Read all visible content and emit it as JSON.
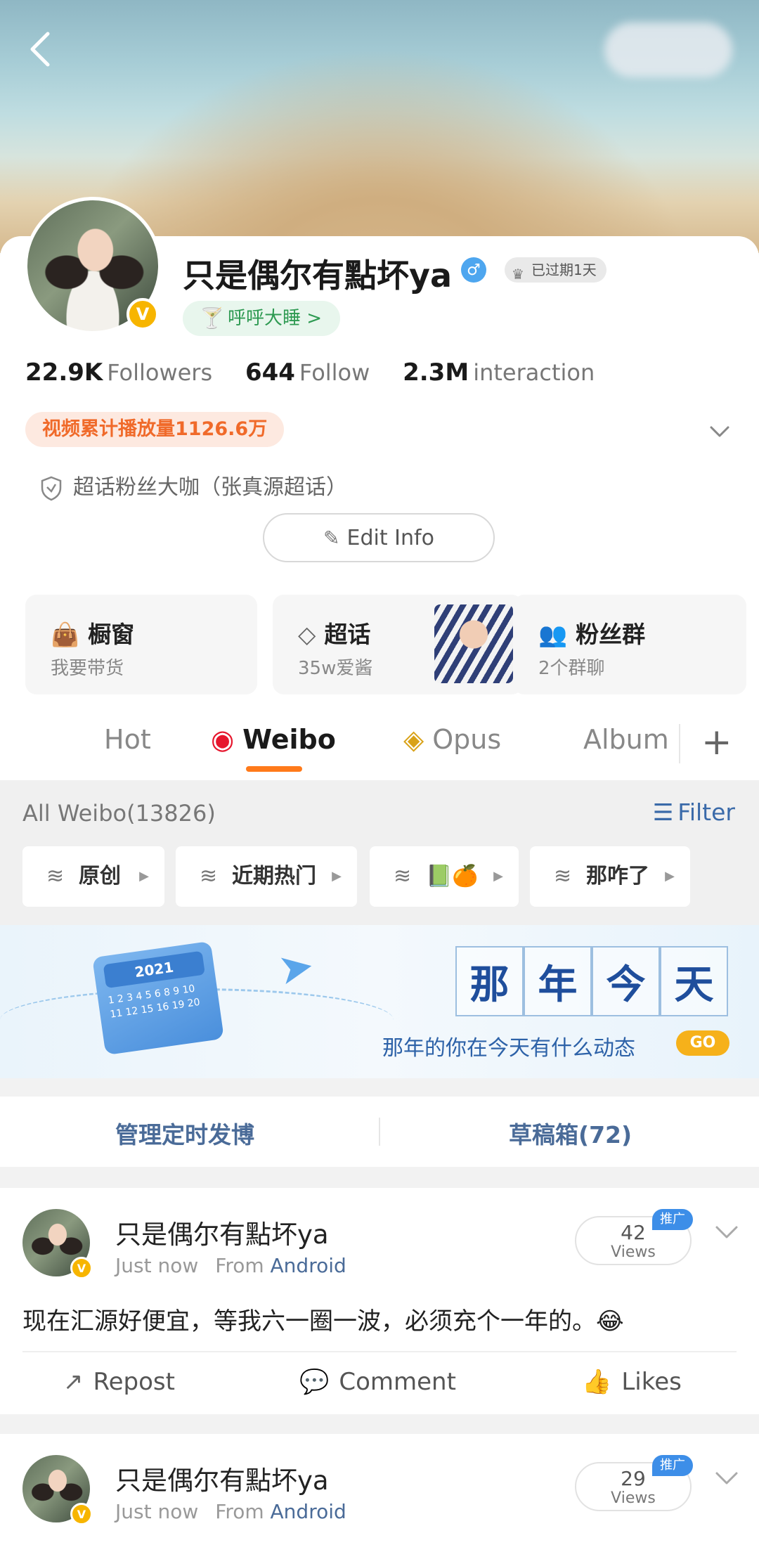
{
  "header": {
    "back_icon": "chevron-left-icon"
  },
  "profile": {
    "name": "只是偶尔有點坏ya",
    "verified_badge": "V",
    "gender_symbol": "♂",
    "member_label": "已过期1天",
    "status_label": "呼呼大睡 >",
    "stats": {
      "followers_value": "22.9K",
      "followers_label": "Followers",
      "follow_value": "644",
      "follow_label": "Follow",
      "interaction_value": "2.3M",
      "interaction_label": "interaction"
    },
    "video_plays": "视频累计播放量1126.6万",
    "super_topic": "超话粉丝大咖（张真源超话）",
    "edit_label": "Edit Info"
  },
  "features": [
    {
      "title": "橱窗",
      "subtitle": "我要带货",
      "icon": "bag-icon"
    },
    {
      "title": "超话",
      "subtitle": "35w爱酱",
      "icon": "diamond-icon"
    },
    {
      "title": "粉丝群",
      "subtitle": "2个群聊",
      "icon": "group-icon"
    }
  ],
  "tabs": [
    {
      "label": "Hot",
      "active": false
    },
    {
      "label": "Weibo",
      "active": true
    },
    {
      "label": "Opus",
      "active": false
    },
    {
      "label": "Album",
      "active": false
    }
  ],
  "filter": {
    "all_label": "All Weibo(13826)",
    "filter_label": "Filter",
    "chips": [
      "原创",
      "近期热门",
      "📗🍊",
      "那咋了"
    ]
  },
  "banner": {
    "calendar_year": "2021",
    "calendar_days": "1 2 3 4 5 6 8 9 10 11 12 15 16 19 20",
    "title_chars": [
      "那",
      "年",
      "今",
      "天"
    ],
    "subtitle": "那年的你在今天有什么动态",
    "go_label": "GO"
  },
  "manage": {
    "scheduled": "管理定时发博",
    "drafts": "草稿箱(72)"
  },
  "posts": [
    {
      "author": "只是偶尔有點坏ya",
      "time": "Just now",
      "from": "From",
      "device": "Android",
      "views_count": "42",
      "views_label": "Views",
      "promo": "推广",
      "text": "现在汇源好便宜，等我六一圈一波，必须充个一年的。😂",
      "repost": "Repost",
      "comment": "Comment",
      "likes": "Likes"
    },
    {
      "author": "只是偶尔有點坏ya",
      "time": "Just now",
      "from": "From",
      "device": "Android",
      "views_count": "29",
      "views_label": "Views",
      "promo": "推广"
    }
  ],
  "colors": {
    "accent_orange": "#ff7a1a",
    "link_blue": "#4a6b98",
    "verified_gold": "#f7b500",
    "status_green": "#2e9a52"
  }
}
